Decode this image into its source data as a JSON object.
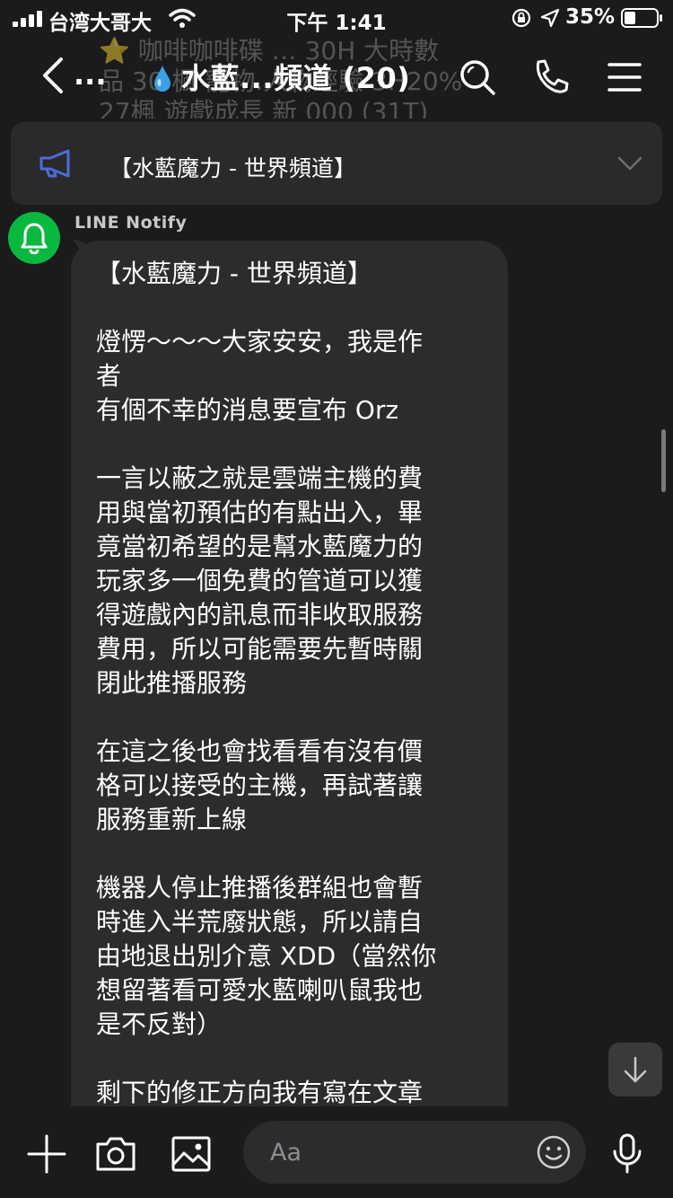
{
  "status_bar": {
    "carrier": "台湾大哥大",
    "time": "下午 1:41",
    "battery": "35%"
  },
  "ghost_banner": {
    "lines": [
      "⭐ 咖啡咖啡碟 … 30H 大時數",
      "品 30 楓 寵物.人物經驗 3H20%",
      "27楓 遊戲成長 新 000 (31T)"
    ]
  },
  "header": {
    "back_label": "...",
    "title": "水藍...頻道 (20)",
    "icons": [
      "back-chevron-icon",
      "search-icon",
      "phone-icon",
      "menu-icon"
    ]
  },
  "announcement": {
    "text": "【水藍魔力 - 世界頻道】",
    "icon": "megaphone-icon"
  },
  "message": {
    "sender": "LINE Notify",
    "avatar_icon": "bell-icon",
    "paragraphs": [
      [
        "【水藍魔力 - 世界頻道】"
      ],
      [
        "燈愣～～～大家安安，我是作",
        "者",
        "有個不幸的消息要宣布 Orz"
      ],
      [
        "一言以蔽之就是雲端主機的費",
        "用與當初預估的有點出入，畢",
        "竟當初希望的是幫水藍魔力的",
        "玩家多一個免費的管道可以獲",
        "得遊戲內的訊息而非收取服務",
        "費用，所以可能需要先暫時關",
        "閉此推播服務"
      ],
      [
        "在這之後也會找看看有沒有價",
        "格可以接受的主機，再試著讓",
        "服務重新上線"
      ],
      [
        "機器人停止推播後群組也會暫",
        "時進入半荒廢狀態，所以請自",
        "由地退出別介意 XDD（當然你",
        "想留著看可愛水藍喇叭鼠我也",
        "是不反對）"
      ],
      [
        "剩下的修正方向我有寫在文章"
      ]
    ]
  },
  "composer": {
    "placeholder": "Aa",
    "icons": [
      "plus-icon",
      "camera-icon",
      "image-icon",
      "emoji-icon",
      "microphone-icon"
    ]
  },
  "colors": {
    "background": "#1b1b1d",
    "bubble": "#2c2c2e",
    "avatar": "#09b83e",
    "megaphone": "#4d6cdb",
    "droplet": "#3aa0e8"
  }
}
